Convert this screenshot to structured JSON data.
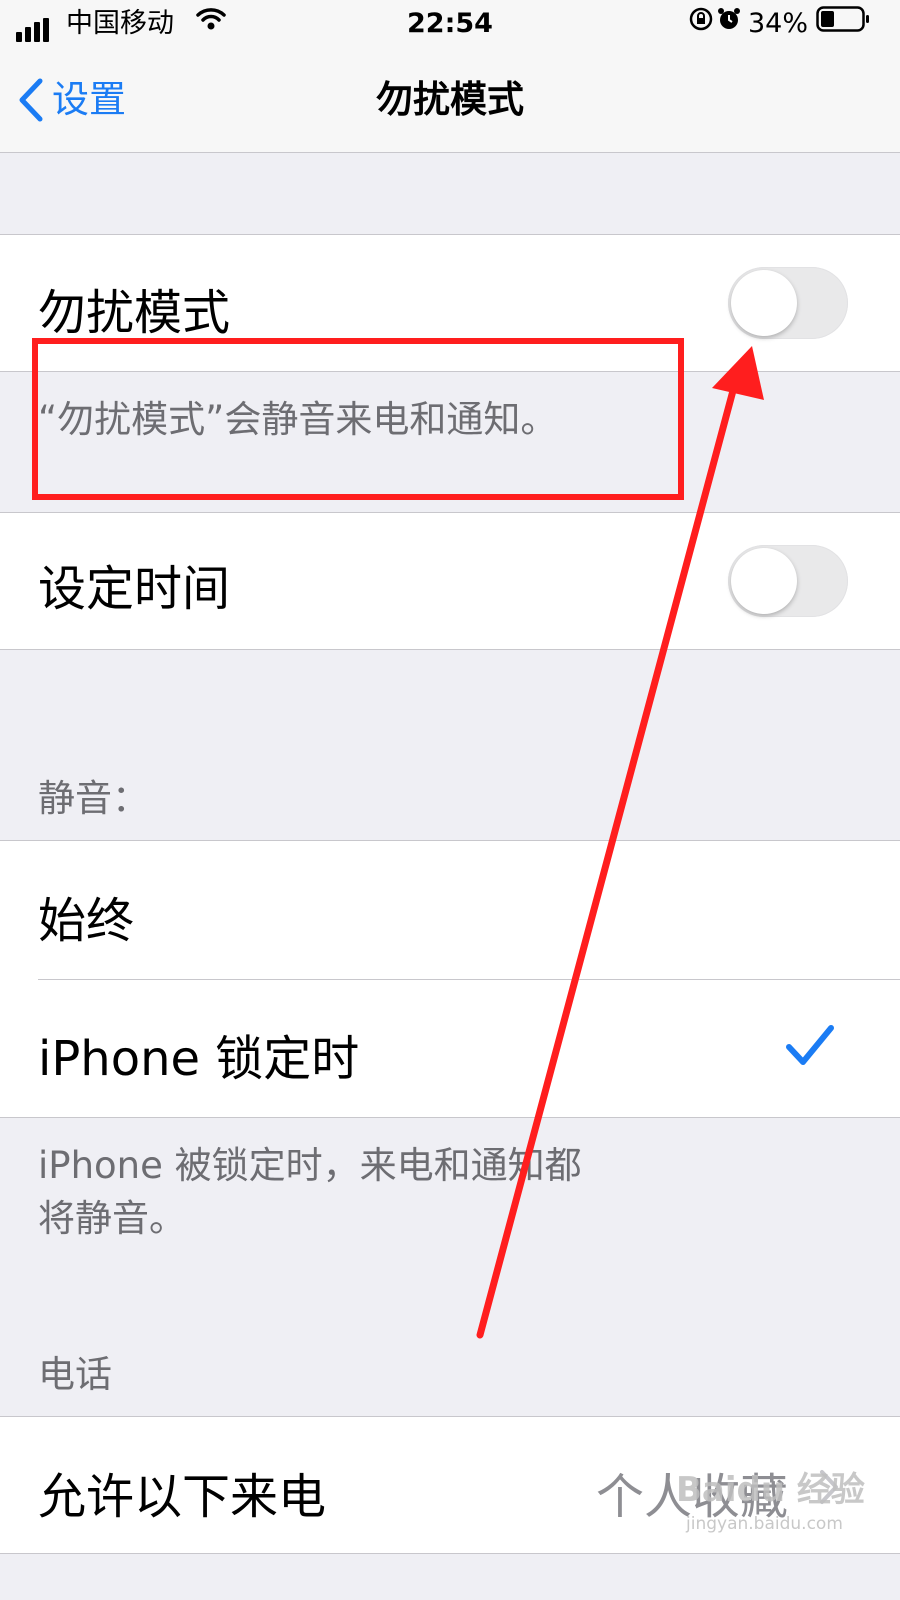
{
  "status_bar": {
    "carrier": "中国移动",
    "time": "22:54",
    "battery": "34%",
    "icons": [
      "signal-icon",
      "wifi-icon",
      "orientation-lock-icon",
      "alarm-icon",
      "battery-icon"
    ]
  },
  "nav": {
    "back_label": "设置",
    "title": "勿扰模式"
  },
  "dnd": {
    "label": "勿扰模式",
    "enabled": false,
    "footer": "“勿扰模式”会静音来电和通知。"
  },
  "scheduled": {
    "label": "设定时间",
    "enabled": false
  },
  "silence": {
    "header": "静音：",
    "options": [
      {
        "label": "始终",
        "selected": false
      },
      {
        "label": "iPhone 锁定时",
        "selected": true
      }
    ],
    "footer_line1": "iPhone 被锁定时，来电和通知都",
    "footer_line2": "将静音。"
  },
  "phone": {
    "header": "电话",
    "allow_calls_label": "允许以下来电",
    "allow_calls_value": "个人收藏"
  },
  "watermark": {
    "text": "Baidu 经验",
    "sub": "jingyan.baidu.com"
  },
  "colors": {
    "accent": "#1b7cf4",
    "annotation": "#ff1e1e",
    "background": "#efeff4"
  }
}
